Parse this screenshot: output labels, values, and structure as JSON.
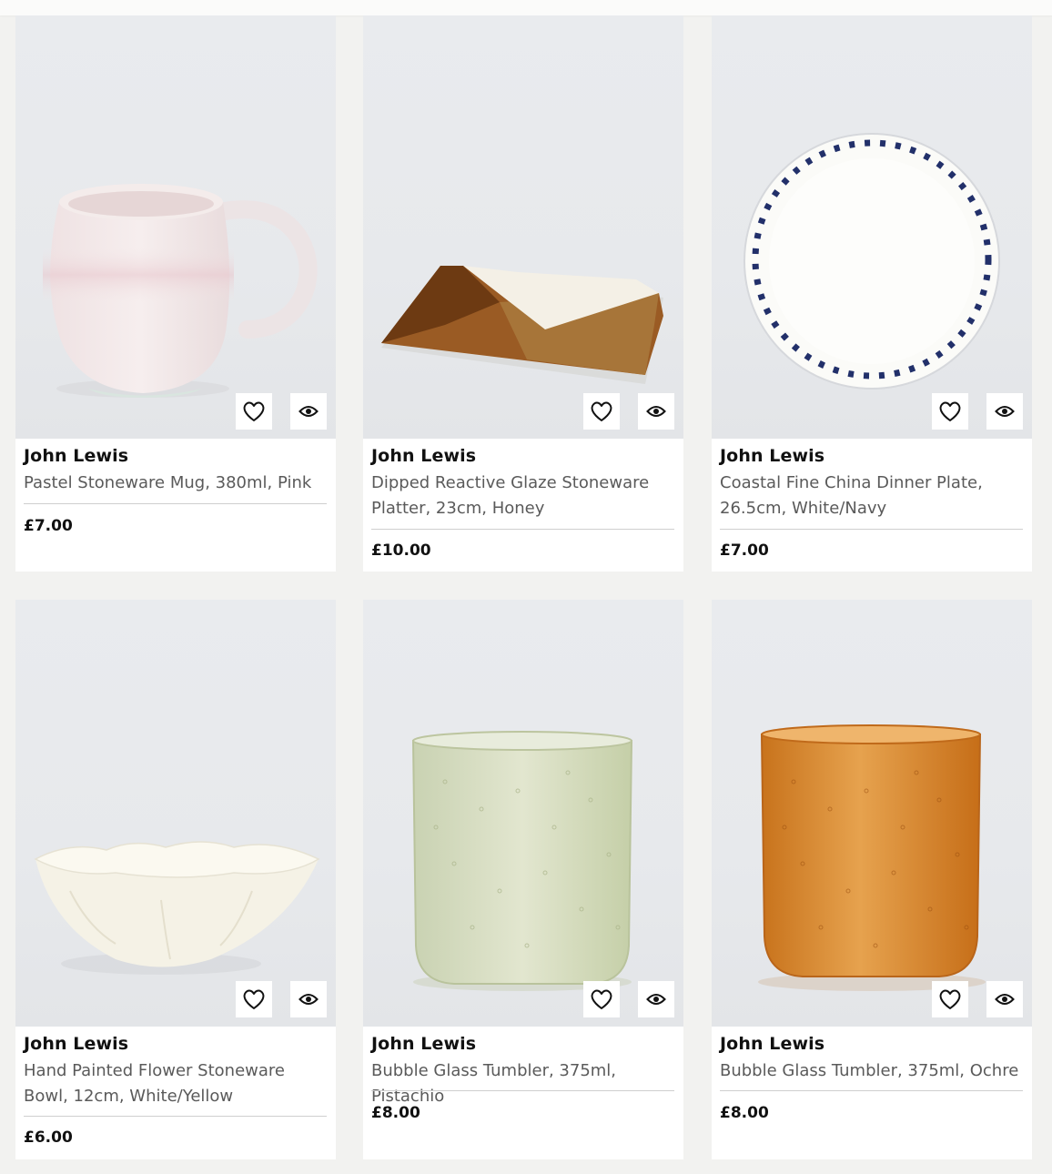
{
  "products": [
    {
      "brand": "John Lewis",
      "title": "Pastel Stoneware Mug, 380ml, Pink",
      "price": "£7.00"
    },
    {
      "brand": "John Lewis",
      "title": "Dipped Reactive Glaze Stoneware Platter, 23cm, Honey",
      "price": "£10.00"
    },
    {
      "brand": "John Lewis",
      "title": "Coastal Fine China Dinner Plate, 26.5cm, White/Navy",
      "price": "£7.00"
    },
    {
      "brand": "John Lewis",
      "title": "Hand Painted Flower Stoneware Bowl, 12cm, White/Yellow",
      "price": "£6.00"
    },
    {
      "brand": "John Lewis",
      "title": "Bubble Glass Tumbler, 375ml, Pistachio",
      "price": "£8.00"
    },
    {
      "brand": "John Lewis",
      "title": "Bubble Glass Tumbler, 375ml, Ochre",
      "price": "£8.00"
    }
  ],
  "icons": {
    "wishlist": "heart-icon",
    "quick_view": "eye-icon"
  },
  "colors": {
    "background": "#f2f2f0",
    "card": "#ffffff",
    "text": "#111111",
    "subtext": "#5a5a5a"
  }
}
